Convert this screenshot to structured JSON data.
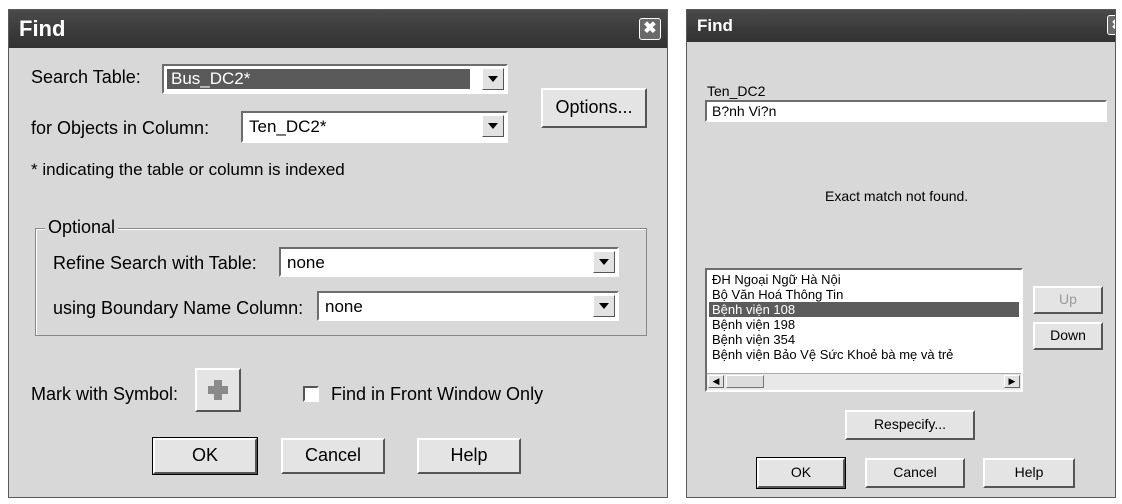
{
  "dialog1": {
    "title": "Find",
    "close_glyph": "✖",
    "search_table_label": "Search Table:",
    "search_table_value": "Bus_DC2*",
    "column_label": "for Objects in Column:",
    "column_value": "Ten_DC2*",
    "options_button": "Options...",
    "index_note": "* indicating the table or column is indexed",
    "optional_group": "Optional",
    "refine_label": "Refine Search with Table:",
    "refine_value": "none",
    "boundary_label": "using Boundary Name Column:",
    "boundary_value": "none",
    "mark_symbol_label": "Mark with Symbol:",
    "front_window_label": "Find in Front Window Only",
    "front_window_checked": false,
    "ok_button": "OK",
    "cancel_button": "Cancel",
    "help_button": "Help"
  },
  "dialog2": {
    "title": "Find",
    "close_glyph": "✖",
    "field_label": "Ten_DC2",
    "field_value": "B?nh Vi?n",
    "message": "Exact match not found.",
    "list_items": [
      "ĐH Ngoại Ngữ Hà Nội",
      "Bộ Văn Hoá Thông Tin",
      "Bệnh viện 108",
      "Bệnh viện 198",
      "Bệnh viện 354",
      "Bệnh viện Bảo Vệ Sức Khoẻ bà mẹ và trẻ"
    ],
    "selected_index": 2,
    "up_button": "Up",
    "down_button": "Down",
    "respecify_button": "Respecify...",
    "ok_button": "OK",
    "cancel_button": "Cancel",
    "help_button": "Help"
  },
  "colors": {
    "titlebar": "#3a3a3a",
    "dialog_bg": "#d8d8d8",
    "selection": "#5c5c5c",
    "symbol": "#8a8a8a"
  }
}
